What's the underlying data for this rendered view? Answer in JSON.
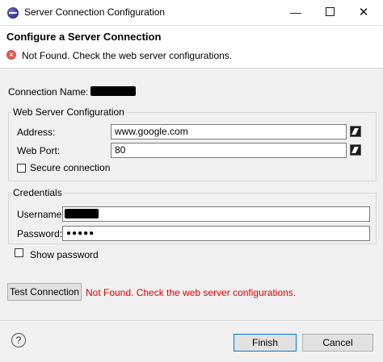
{
  "window": {
    "title": "Server Connection Configuration",
    "minimize_glyph": "—",
    "close_glyph": "✕"
  },
  "header": {
    "title": "Configure a Server Connection",
    "error_glyph": "✕",
    "message": "Not Found. Check the web server configurations."
  },
  "connection": {
    "name_label": "Connection Name:",
    "name_value": ""
  },
  "web_server": {
    "legend": "Web Server Configuration",
    "address_label": "Address:",
    "address_value": "www.google.com",
    "port_label": "Web Port:",
    "port_value": "80",
    "secure_label": "Secure connection"
  },
  "credentials": {
    "legend": "Credentials",
    "username_label": "Username:",
    "username_value": "",
    "password_label": "Password:",
    "password_value": "●●●●●",
    "show_password_label": "Show password"
  },
  "test": {
    "button_label": "Test Connection",
    "error_message": "Not Found. Check the web server configurations."
  },
  "footer": {
    "help_glyph": "?",
    "finish_label": "Finish",
    "cancel_label": "Cancel"
  },
  "colors": {
    "error_red": "#e00000",
    "default_button_border": "#0078d7"
  }
}
